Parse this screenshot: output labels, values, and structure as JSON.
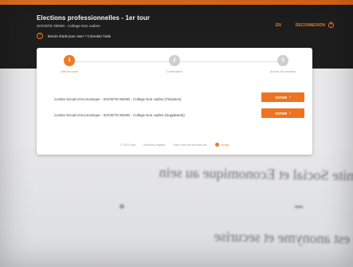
{
  "header": {
    "title": "Elections professionnelles - 1er tour",
    "subtitle": "SOCIETE DEMO - College Non cadres",
    "help_text": "Besoin d'aide pour voter ? Consultez l'aide",
    "lang_label": "EN",
    "logout_label": "DECONNEXION"
  },
  "steps": [
    {
      "num": "1",
      "label": "Vote en cours"
    },
    {
      "num": "2",
      "label": "Confirmation"
    },
    {
      "num": "3",
      "label": "Accuse de reception"
    }
  ],
  "elections": [
    {
      "name": "Comite Social et Economique - SOCIETE DEMO - College Non cadres (Titulaires)",
      "button": "VOTER"
    },
    {
      "name": "Comite Social et Economique - SOCIETE DEMO - College Non cadres (Suppleants)",
      "button": "VOTER"
    }
  ],
  "footer": {
    "copyright": "© 2023 Vote",
    "legal": "Mentions legales",
    "security": "Votre vote est securise par",
    "brand": "Voxaly"
  },
  "background": {
    "ghost_text_1": "Comite Social et Economique au sein",
    "ghost_text_2": "... le vote est anonyme et securise"
  },
  "colors": {
    "accent": "#f07a22",
    "header_bg": "#1e1e1e"
  }
}
